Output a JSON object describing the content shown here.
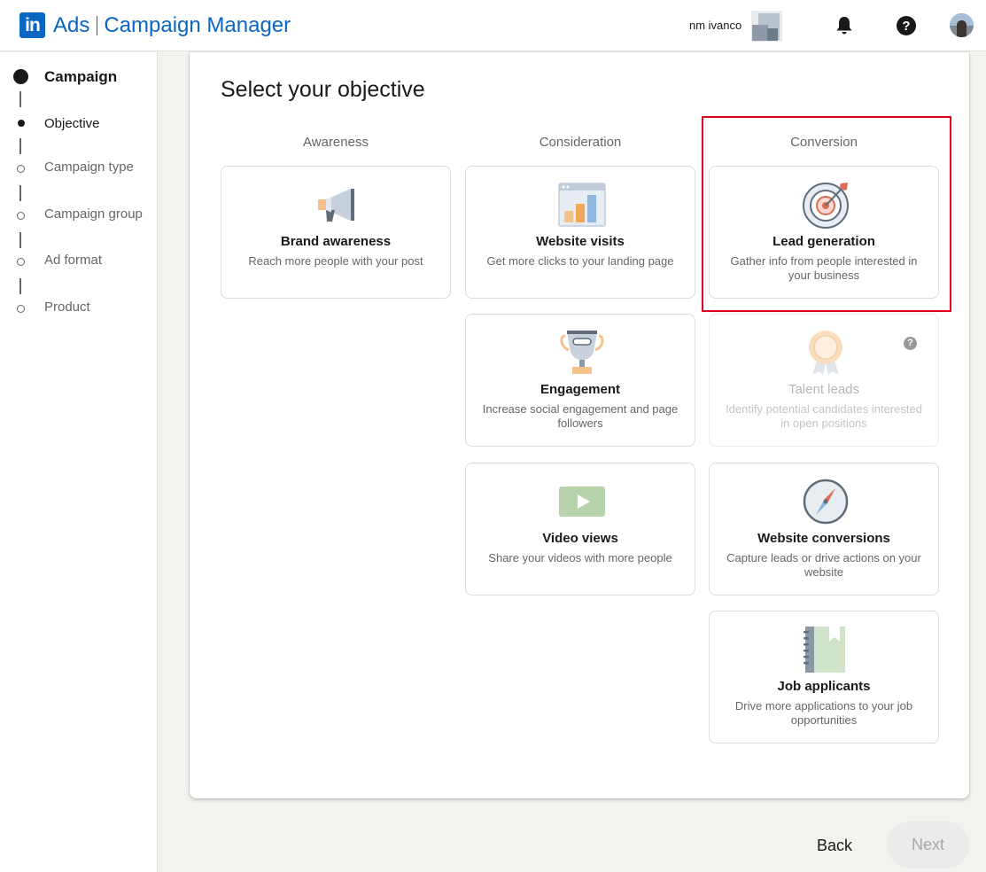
{
  "header": {
    "logo_text": "in",
    "brand_ads": "Ads",
    "brand_product": "Campaign Manager",
    "account_name": "nm ivanco"
  },
  "sidebar": {
    "steps": [
      {
        "label": "Campaign",
        "state": "section"
      },
      {
        "label": "Objective",
        "state": "current"
      },
      {
        "label": "Campaign type",
        "state": "todo"
      },
      {
        "label": "Campaign group",
        "state": "todo"
      },
      {
        "label": "Ad format",
        "state": "todo"
      },
      {
        "label": "Product",
        "state": "todo"
      }
    ]
  },
  "main": {
    "title": "Select your objective",
    "columns": [
      {
        "heading": "Awareness"
      },
      {
        "heading": "Consideration"
      },
      {
        "heading": "Conversion"
      }
    ],
    "objectives": {
      "brand_awareness": {
        "title": "Brand awareness",
        "desc": "Reach more people with your post",
        "icon": "megaphone-icon"
      },
      "website_visits": {
        "title": "Website visits",
        "desc": "Get more clicks to your landing page",
        "icon": "bar-chart-icon"
      },
      "engagement": {
        "title": "Engagement",
        "desc": "Increase social engagement and page followers",
        "icon": "trophy-icon"
      },
      "video_views": {
        "title": "Video views",
        "desc": "Share your videos with more people",
        "icon": "play-icon"
      },
      "lead_generation": {
        "title": "Lead generation",
        "desc": "Gather info from people interested in your business",
        "icon": "target-icon"
      },
      "talent_leads": {
        "title": "Talent leads",
        "desc": "Identify potential candidates interested in open positions",
        "icon": "badge-icon",
        "disabled": true
      },
      "website_conversions": {
        "title": "Website conversions",
        "desc": "Capture leads or drive actions on your website",
        "icon": "compass-icon"
      },
      "job_applicants": {
        "title": "Job applicants",
        "desc": "Drive more applications to your job opportunities",
        "icon": "notebook-icon"
      }
    }
  },
  "footer": {
    "back_label": "Back",
    "next_label": "Next"
  },
  "colors": {
    "brand": "#0a66c2",
    "highlight": "#e0001b"
  }
}
